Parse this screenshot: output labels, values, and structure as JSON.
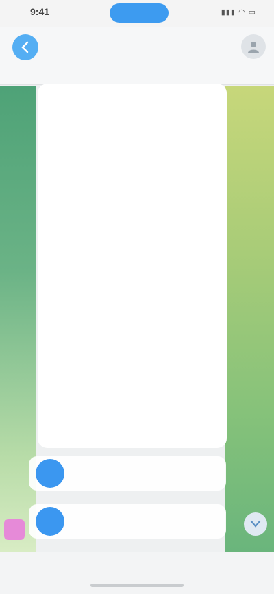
{
  "status_bar": {
    "time": "9:41",
    "indicators": "▮▮▮ ◠ ▭"
  },
  "header": {
    "back_label": "",
    "title": "",
    "subtitle": ""
  },
  "message": {
    "paragraph_1": "",
    "paragraph_2": "",
    "link_text": "",
    "reaction": "",
    "time": ""
  },
  "keyboard": {
    "button_1_label": "",
    "button_2_label": ""
  },
  "colors": {
    "accent": "#3b97f0",
    "wallpaper_left": "#4ea277",
    "wallpaper_right": "#c7d77a",
    "sticker": "#e68ad8"
  },
  "icons": {
    "back": "chevron-left-icon",
    "avatar": "user-icon",
    "scroll": "chevron-down-icon"
  }
}
